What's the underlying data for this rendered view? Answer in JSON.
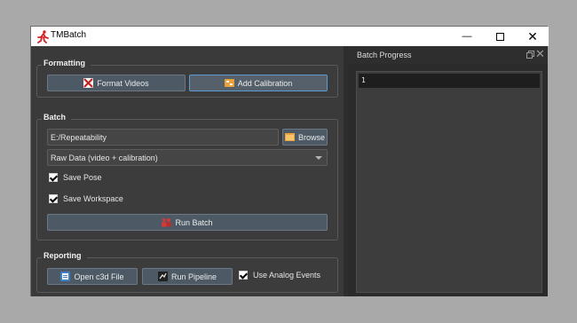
{
  "window": {
    "title": "TMBatch"
  },
  "formatting": {
    "title": "Formatting",
    "format_videos_label": "Format Videos",
    "add_calibration_label": "Add Calibration"
  },
  "batch": {
    "title": "Batch",
    "path_value": "E:/Repeatability",
    "browse_label": "Browse",
    "mode_selected": "Raw Data (video + calibration)",
    "save_pose_label": "Save Pose",
    "save_pose_checked": true,
    "save_workspace_label": "Save Workspace",
    "save_workspace_checked": true,
    "run_batch_label": "Run Batch"
  },
  "reporting": {
    "title": "Reporting",
    "open_c3d_label": "Open c3d File",
    "run_pipeline_label": "Run Pipeline",
    "use_analog_label": "Use Analog Events",
    "use_analog_checked": true
  },
  "progress": {
    "title": "Batch Progress",
    "lines": [
      "1"
    ]
  },
  "icons": {
    "app": "running-man-icon",
    "format_videos": "tools-icon",
    "add_calibration": "calibration-icon",
    "browse": "folder-icon",
    "run_batch": "group-icon",
    "open_c3d": "file-icon",
    "run_pipeline": "pipeline-icon"
  },
  "colors": {
    "accent_blue": "#5c9bd4",
    "button_bg": "#4d5a66",
    "pane_bg": "#3a3a3a",
    "dock_bg": "#2b2b2b"
  }
}
